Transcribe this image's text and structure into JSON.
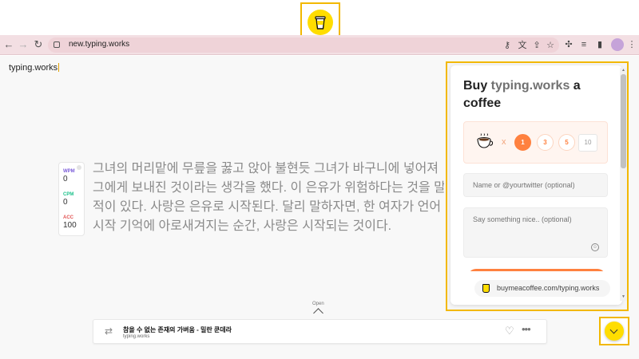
{
  "browser": {
    "url": "new.typing.works"
  },
  "page": {
    "brand": "typing.works",
    "stats": [
      {
        "label": "WPM",
        "value": "0",
        "color": "#7b5cd9"
      },
      {
        "label": "CPM",
        "value": "0",
        "color": "#1fc28c"
      },
      {
        "label": "ACC",
        "value": "100",
        "color": "#e25555"
      }
    ],
    "text_lines": [
      "그녀의 머리맡에 무릎을 꿇고 앉아 불현듯 그녀가 바구니에 넣어져",
      "그에게 보내진 것이라는 생각을 했다. 이 은유가 위험하다는 것을 말",
      "적이 있다. 사랑은 은유로 시작된다. 달리 말하자면, 한 여자가 언어",
      "시작 기억에 아로새겨지는 순간, 사랑은 시작되는 것이다."
    ],
    "open_label": "Open",
    "player": {
      "song": "참을 수 없는 존재의 가벼움 - 밀란 쿤데라",
      "artist": "typing.works"
    }
  },
  "bmc": {
    "title_prefix": "Buy ",
    "title_accent": "typing.works",
    "title_suffix": " a coffee",
    "quantity_options": [
      "1",
      "3",
      "5"
    ],
    "quantity_custom": "10",
    "selected_quantity": "1",
    "name_placeholder": "Name or @yourtwitter (optional)",
    "message_placeholder": "Say something nice.. (optional)",
    "footer_link": "buymeacoffee.com/typing.works",
    "accent_color": "#ff813f",
    "brand_color": "#ffdd00"
  }
}
